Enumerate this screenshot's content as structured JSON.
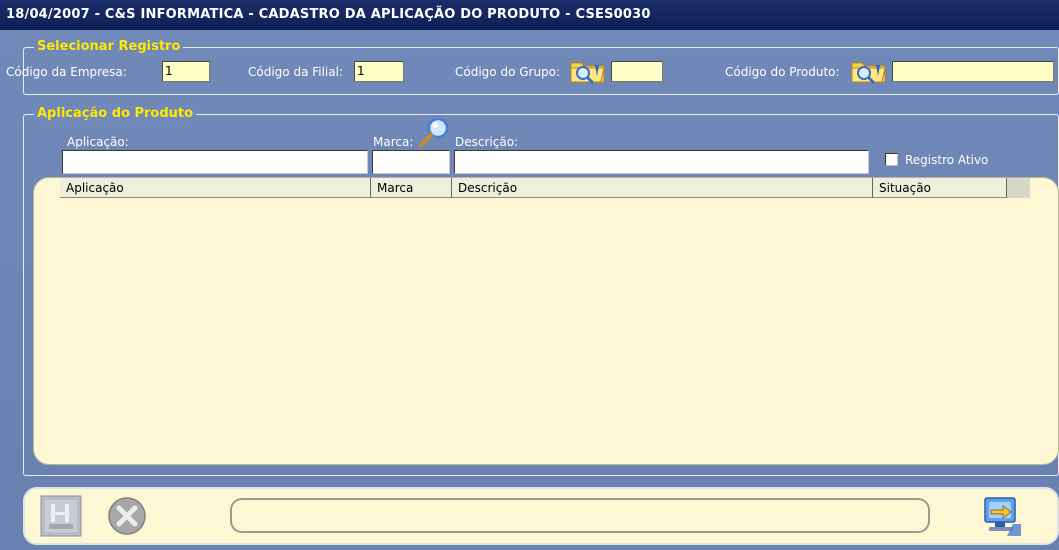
{
  "window": {
    "title": "18/04/2007  -  C&S INFORMATICA  -  CADASTRO DA APLICAÇÃO DO PRODUTO  -  CSES0030"
  },
  "selecionar": {
    "title": "Selecionar Registro",
    "empresa_label": "Código da Empresa:",
    "empresa_value": "1",
    "filial_label": "Código da Filial:",
    "filial_value": "1",
    "grupo_label": "Código do Grupo:",
    "grupo_value": "",
    "produto_label": "Código do Produto:",
    "produto_value": ""
  },
  "aplicacao": {
    "title": "Aplicação do Produto",
    "aplicacao_label": "Aplicação:",
    "marca_label": "Marca:",
    "descricao_label": "Descrição:",
    "registro_ativo_label": "Registro Ativo",
    "registro_ativo_checked": false
  },
  "grid": {
    "columns": [
      "Aplicação",
      "Marca",
      "Descrição",
      "Situação"
    ],
    "rows": []
  },
  "icons": {
    "folder": "folder-search-icon",
    "magnifier": "magnifier-icon",
    "save": "save-icon",
    "cancel": "cancel-icon",
    "exit": "exit-icon"
  },
  "status": {
    "message": ""
  }
}
